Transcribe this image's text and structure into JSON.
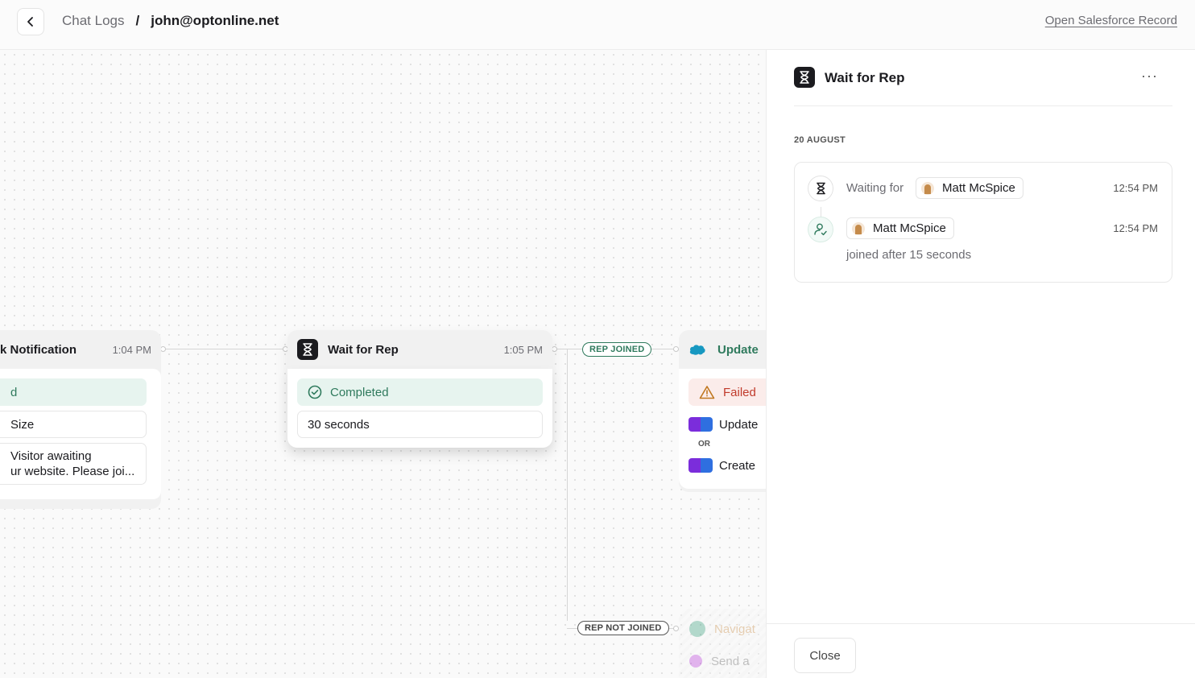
{
  "header": {
    "back_label": "‹",
    "breadcrumb_parent": "Chat Logs",
    "breadcrumb_separator": "/",
    "breadcrumb_current": "john@optonline.net",
    "salesforce_link": "Open Salesforce Record"
  },
  "canvas": {
    "node_notification": {
      "title": "k Notification",
      "time": "1:04 PM",
      "row1": "d",
      "row2": "Size",
      "row3_line1": "Visitor awaiting",
      "row3_line2": "ur website. Please joi..."
    },
    "node_wait": {
      "title": "Wait for Rep",
      "time": "1:05 PM",
      "status": "Completed",
      "duration": "30 seconds"
    },
    "pill_joined": "REP JOINED",
    "pill_not_joined": "REP NOT JOINED",
    "node_update": {
      "title": "Update",
      "status": "Failed",
      "action1": "Update",
      "or_label": "OR",
      "action2": "Create"
    },
    "node_faded": {
      "row1": "Navigat",
      "row2": "Send a"
    }
  },
  "panel": {
    "title": "Wait for Rep",
    "more_label": "···",
    "date_label": "20 AUGUST",
    "events": [
      {
        "text": "Waiting for",
        "person": "Matt McSpice",
        "time": "12:54 PM",
        "icon": "hourglass-icon"
      },
      {
        "text": "joined after 15 seconds",
        "person": "Matt McSpice",
        "time": "12:54 PM",
        "icon": "user-check-icon"
      }
    ],
    "close_label": "Close"
  },
  "colors": {
    "accent_green": "#2f7a5d",
    "success_bg": "#e7f4ef",
    "error_red": "#c03a2b",
    "error_bg": "#fbecea",
    "salesforce_blue": "#1798c1"
  }
}
